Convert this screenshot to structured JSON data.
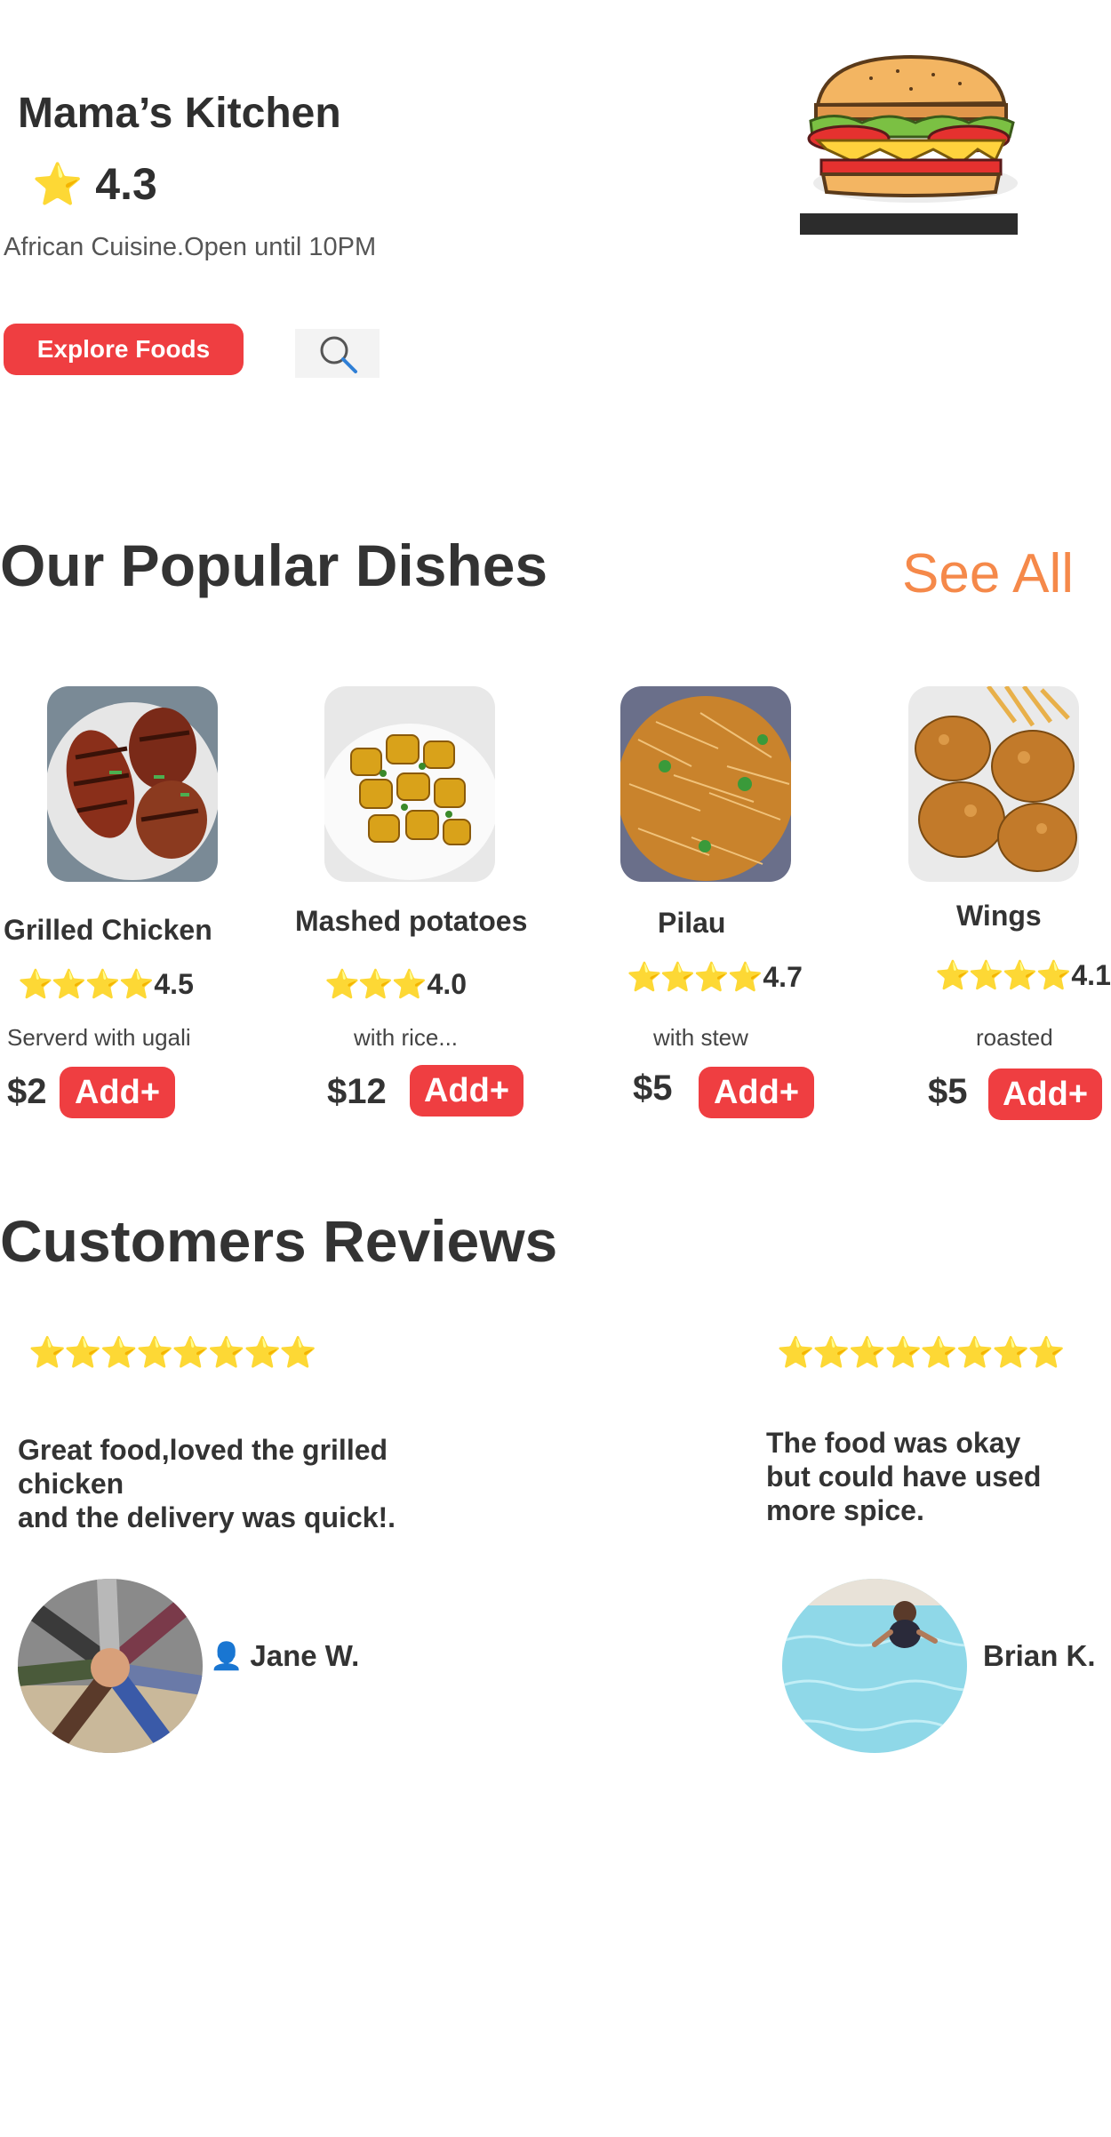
{
  "header": {
    "title": "Mama’s Kitchen",
    "rating_icon": "star-icon",
    "rating": "4.3",
    "subtitle": "African Cuisine.Open until 10PM",
    "explore_label": "Explore Foods",
    "search_icon": "search-icon",
    "hero_image": "sandwich-illustration"
  },
  "popular": {
    "title": "Our Popular Dishes",
    "see_all": "See All",
    "dishes": [
      {
        "name": "Grilled Chicken",
        "stars": "⭐⭐⭐⭐",
        "rating": "4.5",
        "desc": "Serverd with ugali",
        "price": "$2",
        "add": "Add+",
        "image": "grilled-chicken-photo"
      },
      {
        "name": "Mashed potatoes",
        "stars": "⭐⭐⭐",
        "rating": "4.0",
        "desc": "with rice...",
        "price": "$12",
        "add": "Add+",
        "image": "potatoes-photo"
      },
      {
        "name": "Pilau",
        "stars": "⭐⭐⭐⭐",
        "rating": "4.7",
        "desc": "with stew",
        "price": "$5",
        "add": "Add+",
        "image": "pilau-photo"
      },
      {
        "name": "Wings",
        "stars": "⭐⭐⭐⭐",
        "rating": "4.1",
        "desc": "roasted",
        "price": "$5",
        "add": "Add+",
        "image": "wings-photo"
      }
    ]
  },
  "reviews": {
    "title": "Customers Reviews",
    "items": [
      {
        "stars": "⭐⭐⭐⭐⭐⭐⭐⭐",
        "text": "Great food,loved the grilled\nchicken\n and the delivery was quick!.",
        "name": "Jane W.",
        "person_icon": "👤",
        "avatar": "hands-together-photo"
      },
      {
        "stars": "⭐⭐⭐⭐⭐⭐⭐⭐",
        "text": "The food was okay\n but could have used\n more spice.",
        "name": "Brian K.",
        "avatar": "swimming-pool-photo"
      }
    ]
  },
  "colors": {
    "accent_red": "#ef3e41",
    "see_all_orange": "#f5894a",
    "star_gold": "#f6c21a",
    "text_dark": "#333333"
  }
}
